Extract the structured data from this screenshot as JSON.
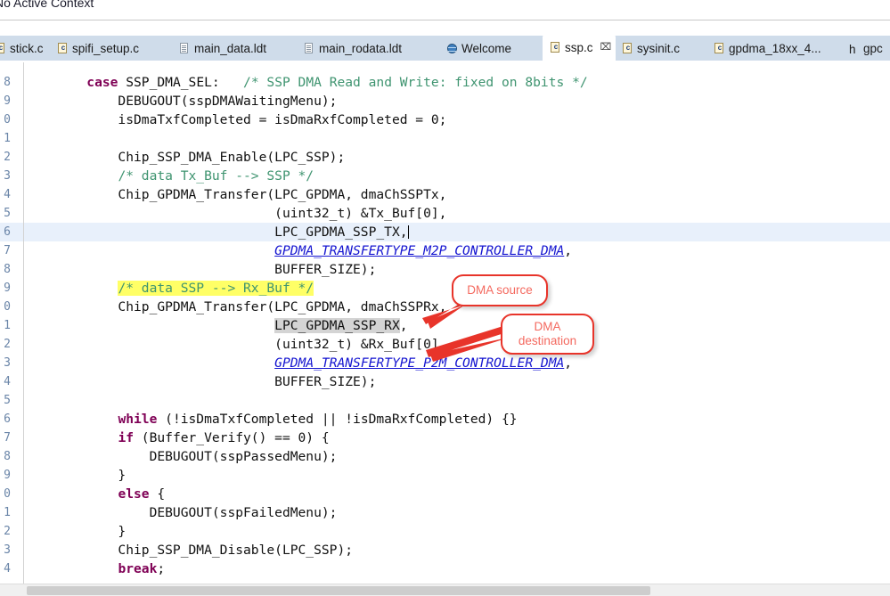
{
  "view_header": {
    "title": "No Active Context"
  },
  "tabs": [
    {
      "label": "stick.c",
      "icon": "c-file-icon",
      "active": false,
      "closable": false
    },
    {
      "label": "spifi_setup.c",
      "icon": "c-file-icon",
      "active": false,
      "closable": false
    },
    {
      "label": "main_data.ldt",
      "icon": "document-icon",
      "active": false,
      "closable": false
    },
    {
      "label": "main_rodata.ldt",
      "icon": "document-icon",
      "active": false,
      "closable": false
    },
    {
      "label": "Welcome",
      "icon": "globe-icon",
      "active": false,
      "closable": false
    },
    {
      "label": "ssp.c",
      "icon": "c-file-icon",
      "active": true,
      "closable": true
    },
    {
      "label": "sysinit.c",
      "icon": "c-file-icon",
      "active": false,
      "closable": false
    },
    {
      "label": "gpdma_18xx_4...",
      "icon": "c-file-icon",
      "active": false,
      "closable": false
    },
    {
      "label": "gpc",
      "icon": "h-file-icon",
      "active": false,
      "closable": false
    }
  ],
  "editor": {
    "file": "ssp.c",
    "close_glyph": "⌧",
    "caret_line_index": 8,
    "lines": [
      {
        "num": "8",
        "text": "        case SSP_DMA_SEL:   /* SSP DMA Read and Write: fixed on 8bits */"
      },
      {
        "num": "9",
        "text": "            DEBUGOUT(sspDMAWaitingMenu);"
      },
      {
        "num": "0",
        "text": "            isDmaTxfCompleted = isDmaRxfCompleted = 0;"
      },
      {
        "num": "1",
        "text": ""
      },
      {
        "num": "2",
        "text": "            Chip_SSP_DMA_Enable(LPC_SSP);"
      },
      {
        "num": "3",
        "text": "            /* data Tx_Buf --> SSP */"
      },
      {
        "num": "4",
        "text": "            Chip_GPDMA_Transfer(LPC_GPDMA, dmaChSSPTx,"
      },
      {
        "num": "5",
        "text": "                                (uint32_t) &Tx_Buf[0],"
      },
      {
        "num": "6",
        "text": "                                LPC_GPDMA_SSP_TX,"
      },
      {
        "num": "7",
        "text": "                                GPDMA_TRANSFERTYPE_M2P_CONTROLLER_DMA,"
      },
      {
        "num": "8",
        "text": "                                BUFFER_SIZE);"
      },
      {
        "num": "9",
        "text": "            /* data SSP --> Rx_Buf */"
      },
      {
        "num": "0",
        "text": "            Chip_GPDMA_Transfer(LPC_GPDMA, dmaChSSPRx,"
      },
      {
        "num": "1",
        "text": "                                LPC_GPDMA_SSP_RX,"
      },
      {
        "num": "2",
        "text": "                                (uint32_t) &Rx_Buf[0],"
      },
      {
        "num": "3",
        "text": "                                GPDMA_TRANSFERTYPE_P2M_CONTROLLER_DMA,"
      },
      {
        "num": "4",
        "text": "                                BUFFER_SIZE);"
      },
      {
        "num": "5",
        "text": ""
      },
      {
        "num": "6",
        "text": "            while (!isDmaTxfCompleted || !isDmaRxfCompleted) {}"
      },
      {
        "num": "7",
        "text": "            if (Buffer_Verify() == 0) {"
      },
      {
        "num": "8",
        "text": "                DEBUGOUT(sspPassedMenu);"
      },
      {
        "num": "9",
        "text": "            }"
      },
      {
        "num": "0",
        "text": "            else {"
      },
      {
        "num": "1",
        "text": "                DEBUGOUT(sspFailedMenu);"
      },
      {
        "num": "2",
        "text": "            }"
      },
      {
        "num": "3",
        "text": "            Chip_SSP_DMA_Disable(LPC_SSP);"
      },
      {
        "num": "4",
        "text": "            break;"
      }
    ],
    "keywords": [
      "case",
      "while",
      "if",
      "else",
      "break"
    ],
    "highlighted_comment": "/* data SSP --> Rx_Buf */",
    "selected_token": "LPC_GPDMA_SSP_RX"
  },
  "annotations": [
    {
      "id": "dma-source",
      "label": "DMA  source",
      "color": "#e8342a",
      "text_color": "#f4695f",
      "points_to": "dmaChSSPRx"
    },
    {
      "id": "dma-destination",
      "label": "DMA\ndestination",
      "color": "#e8342a",
      "text_color": "#f4695f",
      "points_to": "&Rx_Buf[0]"
    }
  ],
  "colors": {
    "keyword": "#7f0055",
    "comment": "#3f9470",
    "static_field": "#1414d0",
    "current_line": "#e8f0fb",
    "search_highlight": "#ffff66",
    "occurrence_highlight": "#d4d4d4",
    "tabbar": "#cfdcea",
    "callout_border": "#e8342a"
  }
}
